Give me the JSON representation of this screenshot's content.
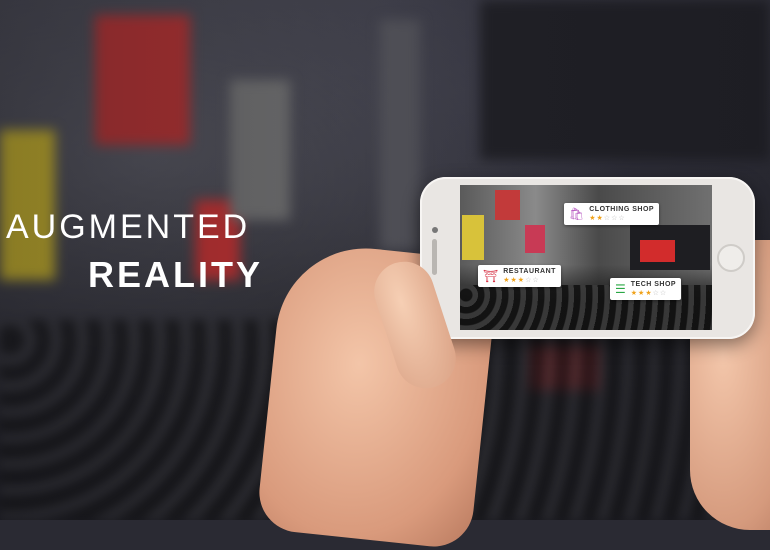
{
  "headline": {
    "line1": "AUGMENTED",
    "line2": "REALITY"
  },
  "ar_tags": [
    {
      "name": "CLOTHING SHOP",
      "icon": "shopping-bag-icon",
      "rating": 2,
      "max": 5,
      "color": "#b85cc2"
    },
    {
      "name": "RESTAURANT",
      "icon": "torii-gate-icon",
      "rating": 3,
      "max": 5,
      "color": "#d8384a"
    },
    {
      "name": "TECH SHOP",
      "icon": "stack-icon",
      "rating": 3,
      "max": 5,
      "color": "#2aa845"
    }
  ]
}
